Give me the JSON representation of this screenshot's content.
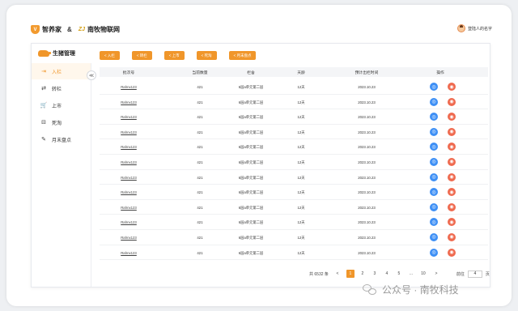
{
  "header": {
    "brand1": "智养家",
    "brand1_badge": "V",
    "amp": "&",
    "brand2": "南牧物联网",
    "brand2_mark": "ZJ",
    "user_name": "登陆人的名字"
  },
  "sidebar": {
    "title": "生猪管理",
    "items": [
      {
        "label": "入栏",
        "icon": "pen-in-icon",
        "glyph": "⇥",
        "active": true
      },
      {
        "label": "转栏",
        "icon": "transfer-icon",
        "glyph": "⇄",
        "active": false
      },
      {
        "label": "上市",
        "icon": "cart-icon",
        "glyph": "🛒",
        "active": false
      },
      {
        "label": "死淘",
        "icon": "cull-icon",
        "glyph": "⊟",
        "active": false
      },
      {
        "label": "月末盘点",
        "icon": "inventory-icon",
        "glyph": "✎",
        "active": false
      }
    ],
    "collapse_glyph": "≪"
  },
  "toolbar": [
    "< 入栏",
    "< 转栏",
    "< 上市",
    "< 死淘",
    "< 月末盘点"
  ],
  "table": {
    "columns": [
      "批次号",
      "当前数量",
      "栏舍",
      "天龄",
      "预计出栏时间",
      "操作"
    ],
    "rows": [
      {
        "batch": "Rahnx123",
        "count": "421",
        "pen": "6层a单元第二层",
        "age": "12天",
        "date": "2023.10.23"
      },
      {
        "batch": "Rahnx123",
        "count": "421",
        "pen": "6层a单元第二层",
        "age": "12天",
        "date": "2023.10.23"
      },
      {
        "batch": "Rahnx123",
        "count": "421",
        "pen": "6层a单元第二层",
        "age": "12天",
        "date": "2023.10.23"
      },
      {
        "batch": "Rahnx123",
        "count": "421",
        "pen": "6层a单元第二层",
        "age": "12天",
        "date": "2023.10.23"
      },
      {
        "batch": "Rahnx123",
        "count": "421",
        "pen": "6层a单元第二层",
        "age": "12天",
        "date": "2023.10.23"
      },
      {
        "batch": "Rahnx123",
        "count": "421",
        "pen": "6层a单元第二层",
        "age": "12天",
        "date": "2023.10.23"
      },
      {
        "batch": "Rahnx123",
        "count": "421",
        "pen": "6层a单元第二层",
        "age": "12天",
        "date": "2023.10.23"
      },
      {
        "batch": "Rahnx123",
        "count": "421",
        "pen": "6层a单元第二层",
        "age": "12天",
        "date": "2023.10.23"
      },
      {
        "batch": "Rahnx123",
        "count": "421",
        "pen": "6层a单元第二层",
        "age": "12天",
        "date": "2023.10.23"
      },
      {
        "batch": "Rahnx123",
        "count": "421",
        "pen": "6层a单元第二层",
        "age": "12天",
        "date": "2023.10.23"
      },
      {
        "batch": "Rahnx123",
        "count": "421",
        "pen": "6层a单元第二层",
        "age": "12天",
        "date": "2023.10.23"
      },
      {
        "batch": "Rahnx123",
        "count": "421",
        "pen": "6层a单元第二层",
        "age": "12天",
        "date": "2023.10.23"
      }
    ],
    "view_glyph": "◎",
    "delete_glyph": "◉"
  },
  "pagination": {
    "total_text": "共 6532 条",
    "prev": "<",
    "pages": [
      "1",
      "2",
      "3",
      "4",
      "5",
      "...",
      "10"
    ],
    "current": "1",
    "next": ">",
    "goto_label": "前往",
    "goto_value": "4",
    "goto_suffix": "页"
  },
  "watermark": "公众号 · 南牧科技",
  "colors": {
    "accent": "#f0962a",
    "view": "#3d8ff5",
    "delete": "#ef6a4f"
  }
}
